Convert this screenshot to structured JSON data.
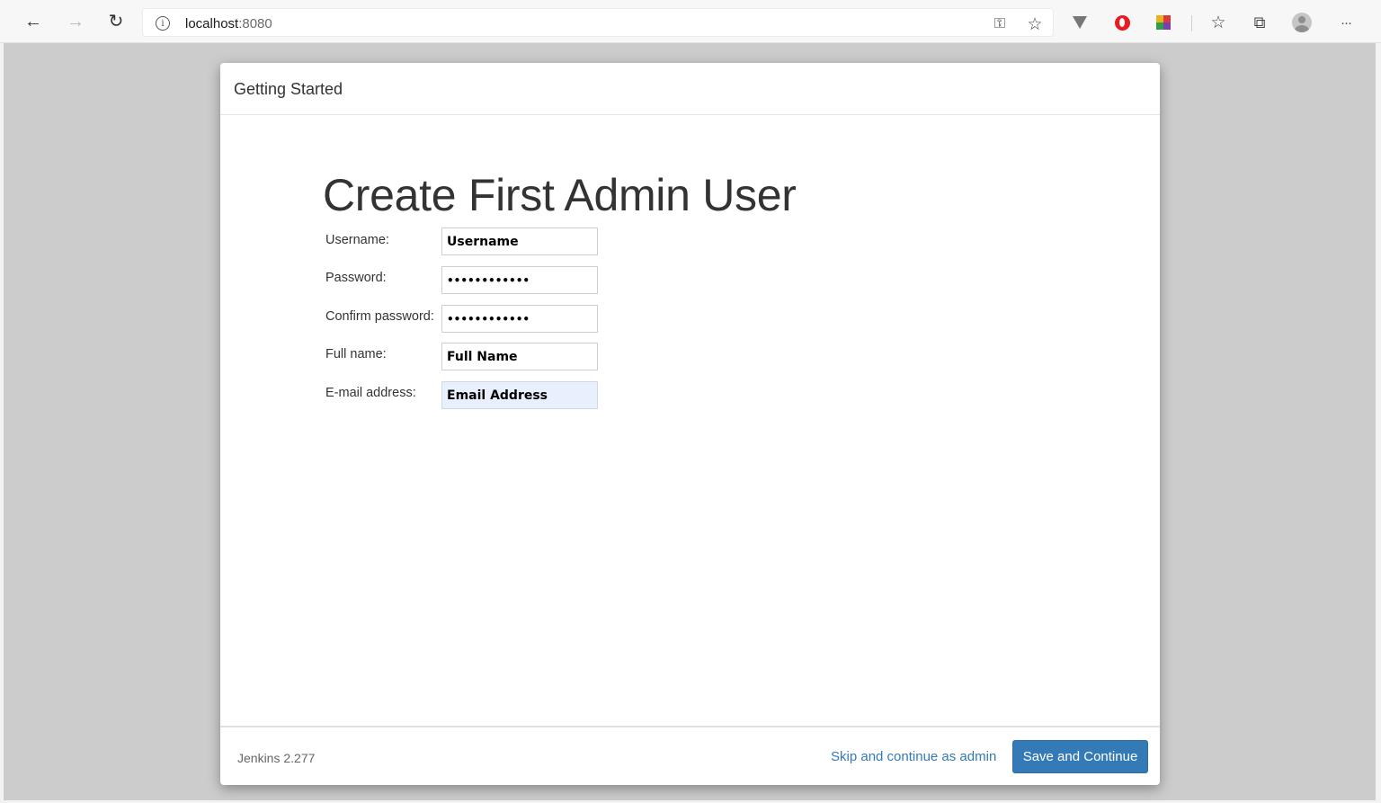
{
  "browser": {
    "url_host": "localhost",
    "url_port": ":8080",
    "icons": {
      "back": "←",
      "forward": "→",
      "reload": "↻",
      "info": "i",
      "key": "⚿",
      "add_favorite": "☆",
      "favorites": "☆",
      "collections": "⧉",
      "more": "···"
    }
  },
  "dialog": {
    "header_title": "Getting Started",
    "form_title": "Create First Admin User",
    "fields": [
      {
        "label": "Username:",
        "value": "Username"
      },
      {
        "label": "Password:",
        "value": "••••••••••••"
      },
      {
        "label": "Confirm password:",
        "value": "••••••••••••"
      },
      {
        "label": "Full name:",
        "value": "Full Name"
      },
      {
        "label": "E-mail address:",
        "value": "Email Address"
      }
    ],
    "footer": {
      "version": "Jenkins 2.277",
      "skip_label": "Skip and continue as admin",
      "save_label": "Save and Continue"
    }
  },
  "colors": {
    "primary_button": "#337ab7",
    "link": "#337ab7",
    "backdrop": "#cccccc",
    "autofill": "#e8f0fe"
  }
}
